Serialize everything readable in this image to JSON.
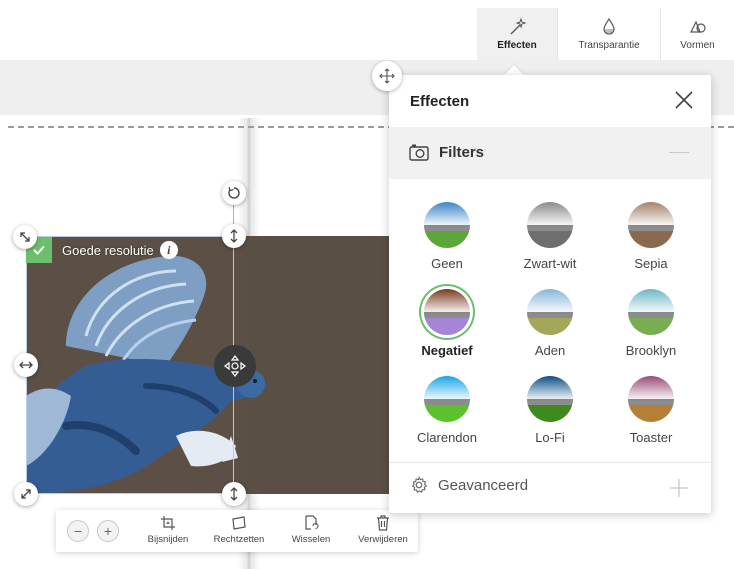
{
  "toolbar": {
    "tabs": [
      {
        "label": "Effecten",
        "icon": "magic-wand-icon",
        "active": true
      },
      {
        "label": "Transparantie",
        "icon": "drop-icon",
        "active": false
      },
      {
        "label": "Vormen",
        "icon": "shapes-icon",
        "active": false
      }
    ]
  },
  "photo": {
    "resolution_label": "Goede resolutie",
    "info_symbol": "i"
  },
  "actions": {
    "zoom_out": "−",
    "zoom_in": "+",
    "items": [
      {
        "label": "Bijsnijden",
        "icon": "crop-icon"
      },
      {
        "label": "Rechtzetten",
        "icon": "straighten-icon"
      },
      {
        "label": "Wisselen",
        "icon": "swap-icon"
      },
      {
        "label": "Verwijderen",
        "icon": "trash-icon"
      }
    ]
  },
  "panel": {
    "title": "Effecten",
    "filters_heading": "Filters",
    "filters": [
      {
        "name": "Geen",
        "sky": "#3b86c9",
        "grass": "#5aa73a",
        "selected": false
      },
      {
        "name": "Zwart-wit",
        "sky": "#8a8a8a",
        "grass": "#6e6e6e",
        "selected": false
      },
      {
        "name": "Sepia",
        "sky": "#a5826a",
        "grass": "#8a6a4f",
        "selected": false
      },
      {
        "name": "Negatief",
        "sky": "#7a3a1e",
        "grass": "#a585d6",
        "selected": true
      },
      {
        "name": "Aden",
        "sky": "#86b6dc",
        "grass": "#a4a65a",
        "selected": false
      },
      {
        "name": "Brooklyn",
        "sky": "#6fb6c9",
        "grass": "#78ad52",
        "selected": false
      },
      {
        "name": "Clarendon",
        "sky": "#18a6e6",
        "grass": "#59c22c",
        "selected": false
      },
      {
        "name": "Lo-Fi",
        "sky": "#0e4f86",
        "grass": "#3e8a1e",
        "selected": false
      },
      {
        "name": "Toaster",
        "sky": "#9a4c78",
        "grass": "#b48036",
        "selected": false
      }
    ],
    "advanced_label": "Geavanceerd"
  },
  "colors": {
    "accent_green": "#6cbf6c",
    "photo_bg": "#5c5046",
    "panel_header_bg": "#f1f1f1"
  }
}
